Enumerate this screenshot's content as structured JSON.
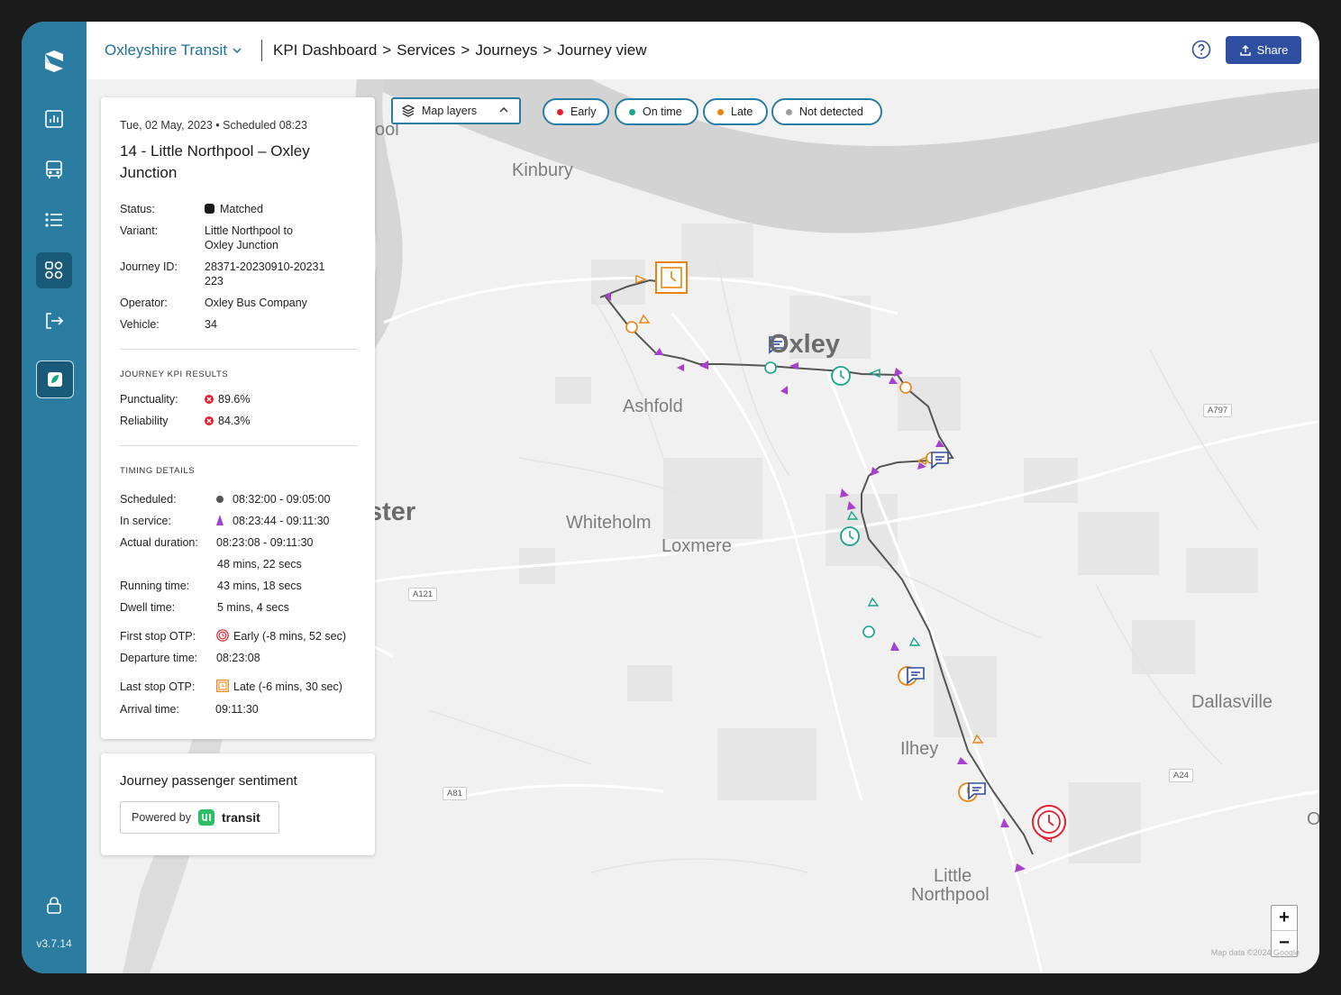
{
  "app": {
    "org": "Oxleyshire Transit",
    "version": "v3.7.14"
  },
  "breadcrumb": [
    "KPI Dashboard",
    "Services",
    "Journeys",
    "Journey view"
  ],
  "header": {
    "share_label": "Share"
  },
  "journey": {
    "date_line": "Tue, 02 May, 2023 • Scheduled 08:23",
    "title": "14 - Little Northpool – Oxley Junction",
    "status_label": "Status:",
    "status": "Matched",
    "variant_label": "Variant:",
    "variant_line1": "Little Northpool to",
    "variant_line2": "Oxley Junction",
    "journey_id_label": "Journey ID:",
    "journey_id_line1": "28371-20230910-20231",
    "journey_id_line2": "223",
    "operator_label": "Operator:",
    "operator": "Oxley Bus Company",
    "vehicle_label": "Vehicle:",
    "vehicle": "34"
  },
  "kpi": {
    "heading": "JOURNEY KPI RESULTS",
    "punctuality_label": "Punctuality:",
    "punctuality": "89.6%",
    "reliability_label": "Reliability",
    "reliability": "84.3%"
  },
  "timing": {
    "heading": "TIMING DETAILS",
    "scheduled_label": "Scheduled:",
    "scheduled": "08:32:00 - 09:05:00",
    "in_service_label": "In service:",
    "in_service": "08:23:44 - 09:11:30",
    "actual_label": "Actual duration:",
    "actual": "08:23:08 - 09:11:30",
    "actual_total": "48 mins, 22 secs",
    "running_label": "Running time:",
    "running": "43 mins, 18 secs",
    "dwell_label": "Dwell time:",
    "dwell": "5 mins, 4 secs",
    "first_otp_label": "First stop OTP:",
    "first_otp": "Early (-8 mins, 52 sec)",
    "departure_label": "Departure time:",
    "departure": "08:23:08",
    "last_otp_label": "Last stop OTP:",
    "last_otp": "Late (-6 mins, 30 sec)",
    "arrival_label": "Arrival time:",
    "arrival": "09:11:30"
  },
  "sentiment": {
    "title": "Journey passenger sentiment",
    "powered_by": "Powered by",
    "brand": "transit"
  },
  "map": {
    "layers_label": "Map layers",
    "legend": [
      {
        "label": "Early",
        "color": "#e5202e"
      },
      {
        "label": "On time",
        "color": "#1aa489"
      },
      {
        "label": "Late",
        "color": "#ea8312"
      },
      {
        "label": "Not detected",
        "color": "#9e9e9e"
      }
    ],
    "places": [
      "Kinbury",
      "Oxley",
      "Ashfold",
      "Whiteholm",
      "Loxmere",
      "Dallasville",
      "Ilhey",
      "Little",
      "Northpool",
      "ster",
      "ool",
      "O"
    ],
    "roads": [
      "A797",
      "A121",
      "A81",
      "A24"
    ],
    "zoom_in": "+",
    "zoom_out": "−",
    "attribution": "Map data ©2024 Google",
    "colors": {
      "route": "#555555",
      "arrow": "#a93fd1",
      "comment": "#2e4ea2"
    }
  }
}
